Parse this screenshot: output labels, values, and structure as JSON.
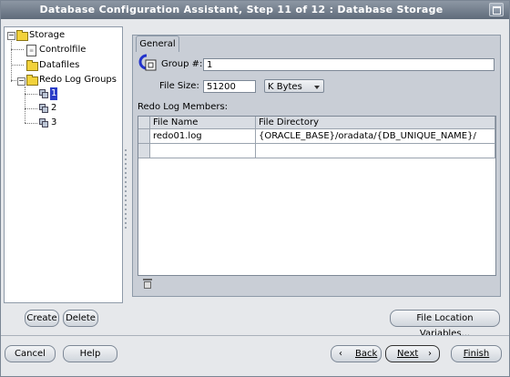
{
  "window": {
    "title": "Database Configuration Assistant, Step 11 of 12 : Database Storage"
  },
  "tree": {
    "root": "Storage",
    "controlfile": "Controlfile",
    "datafiles": "Datafiles",
    "redo_groups": "Redo Log Groups",
    "groups": [
      "1",
      "2",
      "3"
    ]
  },
  "tab": {
    "label": "General"
  },
  "form": {
    "group_label": "Group #:",
    "group_value": "1",
    "size_label": "File Size:",
    "size_value": "51200",
    "unit_selected": "K Bytes",
    "members_label": "Redo Log Members:"
  },
  "table": {
    "columns": [
      "File Name",
      "File Directory"
    ],
    "rows": [
      [
        "redo01.log",
        "{ORACLE_BASE}/oradata/{DB_UNIQUE_NAME}/"
      ],
      [
        "",
        ""
      ]
    ]
  },
  "buttons": {
    "create": "Create",
    "delete": "Delete",
    "file_location": "File Location Variables...",
    "cancel": "Cancel",
    "help": "Help",
    "back": "Back",
    "next": "Next",
    "finish": "Finish"
  },
  "icons": {
    "tree_folder": "folder-icon",
    "tree_doc": "controlfile-icon",
    "tree_log": "redo-log-icon",
    "delete_member": "trash-icon",
    "group_header": "redo-group-icon"
  }
}
